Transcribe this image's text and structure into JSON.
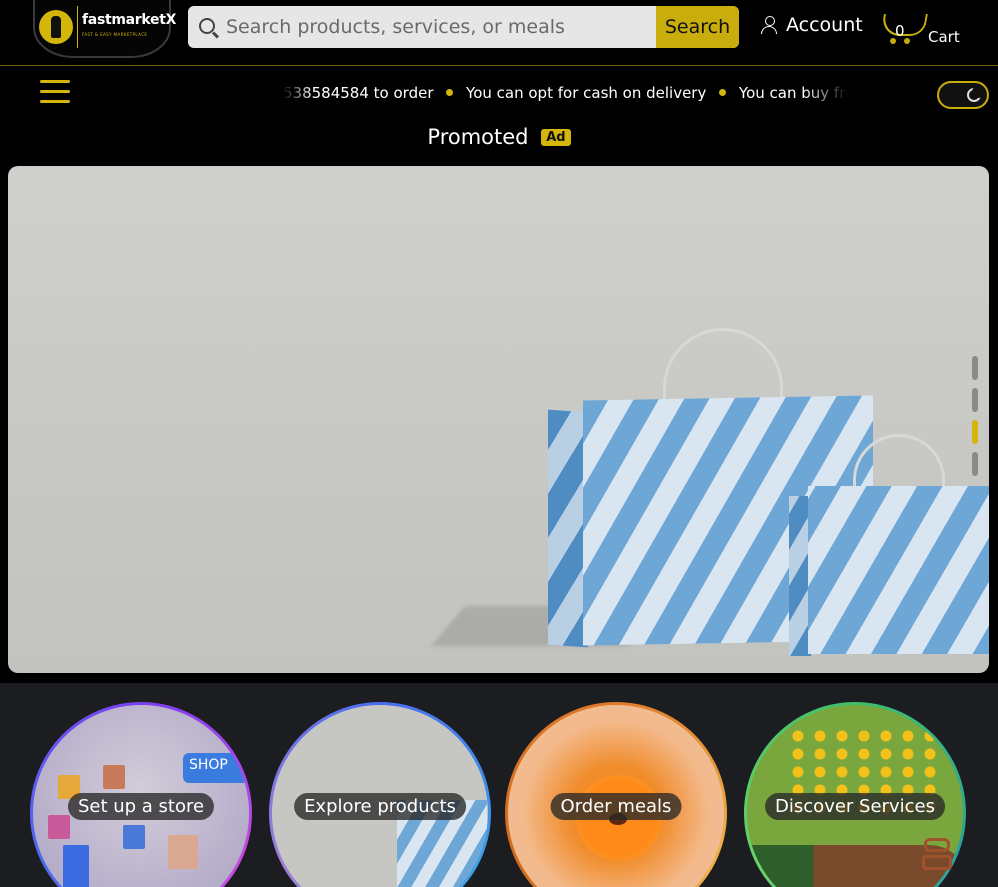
{
  "brand": {
    "name": "fastmarketX",
    "tagline": "FAST & EASY MARKETPLACE"
  },
  "search": {
    "placeholder": "Search products, services, or meals",
    "button": "Search"
  },
  "account": {
    "label": "Account"
  },
  "cart": {
    "count": "0",
    "label": "Cart"
  },
  "ticker": {
    "items": [
      "538584584 to order",
      "You can opt for cash on delivery",
      "You can buy from m"
    ]
  },
  "promoted": {
    "label": "Promoted",
    "badge": "Ad"
  },
  "banner": {
    "slides": 4,
    "active_slide": 3
  },
  "categories": [
    {
      "label": "Set up a store"
    },
    {
      "label": "Explore products"
    },
    {
      "label": "Order meals"
    },
    {
      "label": "Discover Services"
    }
  ],
  "colors": {
    "accent": "#d4b50a",
    "background": "#000000",
    "panel": "#1b1d20"
  },
  "icons": [
    "logo-icon",
    "search-icon",
    "user-icon",
    "cart-icon",
    "menu-icon",
    "moon-icon",
    "robot-icon"
  ]
}
